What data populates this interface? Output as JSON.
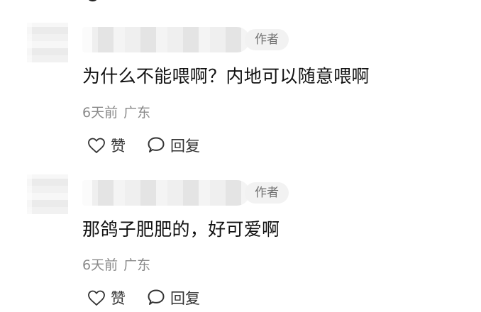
{
  "comments": [
    {
      "author_tag": "作者",
      "text": "为什么不能喂啊？内地可以随意喂啊",
      "time": "6天前",
      "location": "广东",
      "like_label": "赞",
      "reply_label": "回复"
    },
    {
      "author_tag": "作者",
      "text": "那鸽子肥肥的，好可爱啊",
      "time": "6天前",
      "location": "广东",
      "like_label": "赞",
      "reply_label": "回复"
    }
  ],
  "colors": {
    "meta_gray": "#8a8a8a",
    "tag_background": "#f2f2f2",
    "text": "#111111"
  }
}
